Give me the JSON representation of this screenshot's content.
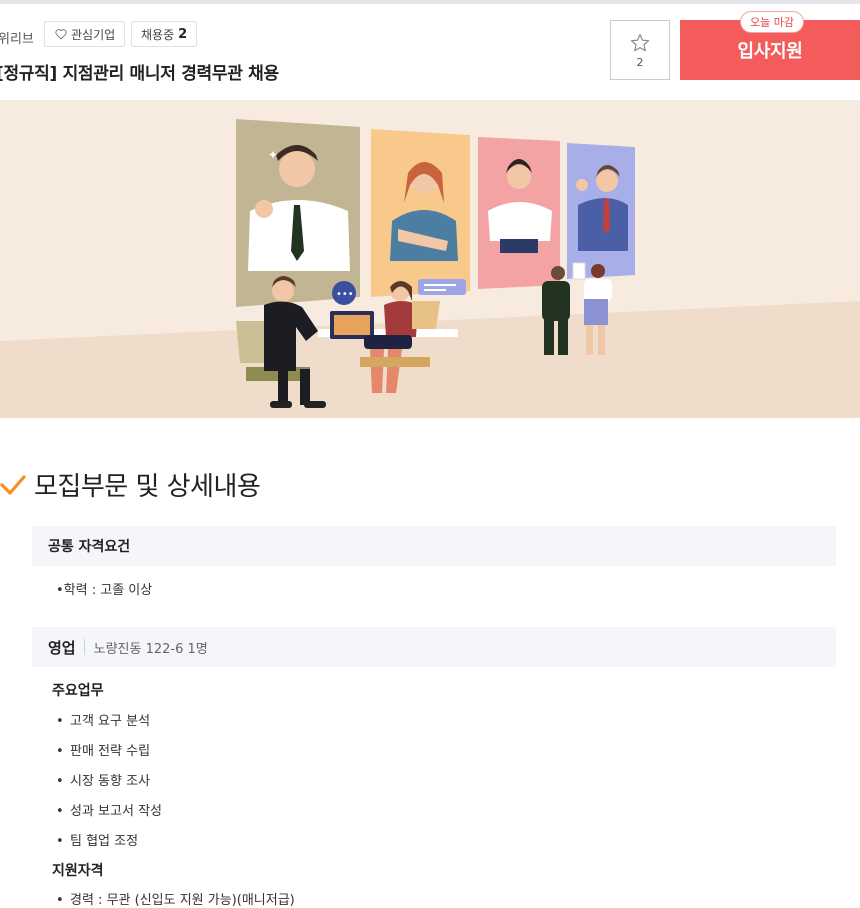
{
  "header": {
    "company_fragment": "위리브",
    "favorite_label": "관심기업",
    "hiring_label": "채용중",
    "hiring_count": "2",
    "job_title": "[정규직] 지점관리 매니저 경력무관 채용",
    "scrap_count": "2",
    "apply_label": "입사지원",
    "deadline_badge": "오늘 마감",
    "accent_color": "#f45b5b"
  },
  "content": {
    "section_title": "모집부문 및 상세내용",
    "common": {
      "heading": "공통 자격요건",
      "items": [
        "학력 : 고졸 이상"
      ]
    },
    "position": {
      "name": "영업",
      "location": "노량진동 122-6 1명",
      "duties_heading": "주요업무",
      "duties": [
        "고객 요구 분석",
        "판매 전략 수립",
        "시장 동향 조사",
        "성과 보고서 작성",
        "팀 협업 조정"
      ],
      "qual_heading": "지원자격",
      "qual_items": [
        "경력 : 무관 (신입도 지원 가능)(매니저급)"
      ]
    }
  },
  "icons": {
    "heart": "heart-outline-icon",
    "star": "star-outline-icon",
    "check": "checkmark-icon"
  }
}
